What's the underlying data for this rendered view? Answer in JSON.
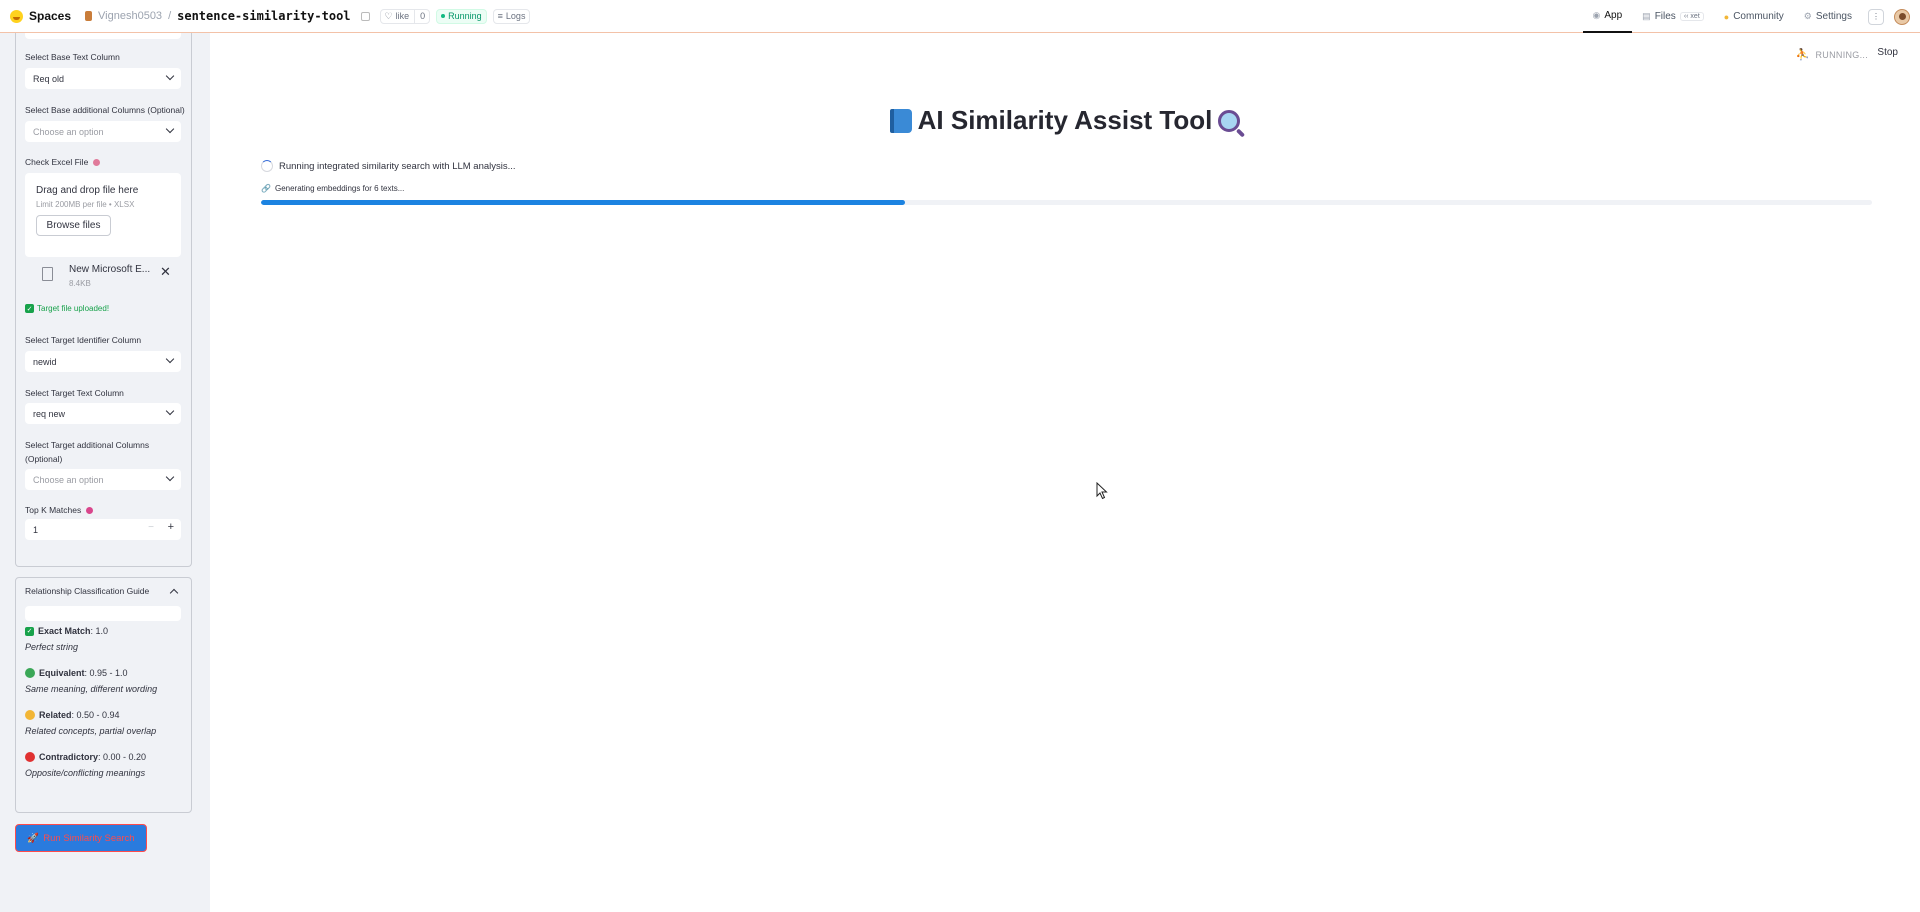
{
  "header": {
    "spaces_label": "Spaces",
    "owner": "Vignesh0503",
    "separator": "/",
    "repo": "sentence-similarity-tool",
    "like_label": "like",
    "like_count": "0",
    "running_label": "Running",
    "logs_label": "Logs",
    "nav": {
      "app": "App",
      "files": "Files",
      "xet": "xet",
      "community": "Community",
      "settings": "Settings"
    }
  },
  "sidebar": {
    "base_text_label": "Select Base Text Column",
    "base_text_value": "Req old",
    "base_additional_label": "Select Base additional Columns (Optional)",
    "base_additional_placeholder": "Choose an option",
    "check_file_label": "Check Excel File",
    "dropzone_title": "Drag and drop file here",
    "dropzone_sub": "Limit 200MB per file • XLSX",
    "browse_label": "Browse files",
    "file_name": "New Microsoft E...",
    "file_size": "8.4KB",
    "upload_success": "Target file uploaded!",
    "target_id_label": "Select Target Identifier Column",
    "target_id_value": "newid",
    "target_text_label": "Select Target Text Column",
    "target_text_value": "req new",
    "target_additional_label_1": "Select Target additional Columns",
    "target_additional_label_2": "(Optional)",
    "target_additional_placeholder": "Choose an option",
    "topk_label": "Top K Matches",
    "topk_value": "1",
    "guide": {
      "title": "Relationship Classification Guide",
      "items": [
        {
          "name": "Exact Match",
          "range": ": 1.0",
          "desc": "Perfect string",
          "icon": "check-emoji",
          "color": "#18a24b"
        },
        {
          "name": "Equivalent",
          "range": ": 0.95 - 1.0",
          "desc": "Same meaning, different wording",
          "icon": "green-circle",
          "color": "#3aa757"
        },
        {
          "name": "Related",
          "range": ": 0.50 - 0.94",
          "desc": "Related concepts, partial overlap",
          "icon": "yellow-circle",
          "color": "#f2b636"
        },
        {
          "name": "Contradictory",
          "range": ": 0.00 - 0.20",
          "desc": "Opposite/conflicting meanings",
          "icon": "red-circle",
          "color": "#e03131"
        }
      ]
    },
    "run_button": "Run Similarity Search"
  },
  "main": {
    "status": "RUNNING...",
    "stop_label": "Stop",
    "title": "AI Similarity Assist Tool",
    "spinner_text": "Running integrated similarity search with LLM analysis...",
    "embedding_text": "Generating embeddings for 6 texts...",
    "progress_fraction": 0.4
  },
  "colors": {
    "accent": "#1c83e1",
    "sidebar_bg": "#f0f2f6",
    "danger": "#ff4b4b",
    "success": "#18a24b"
  }
}
